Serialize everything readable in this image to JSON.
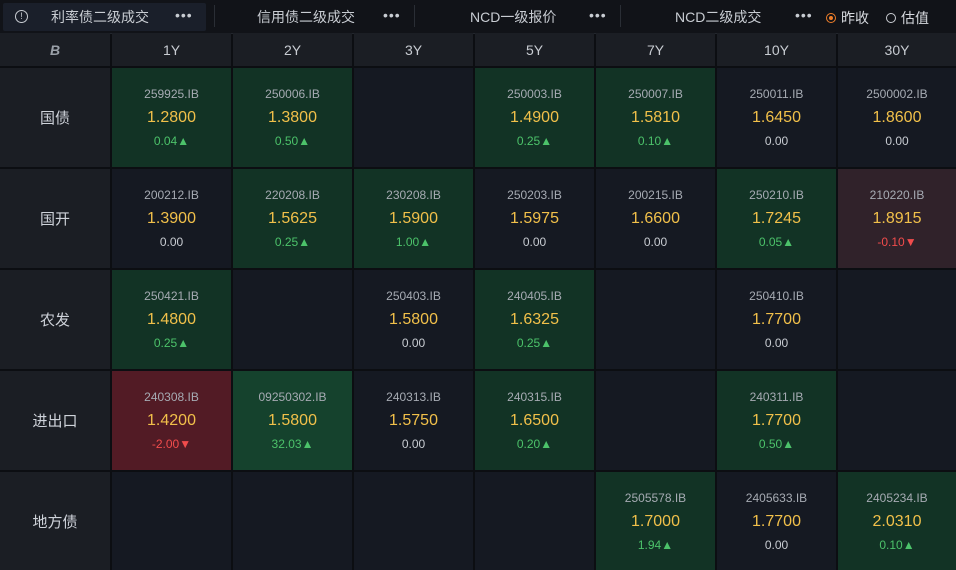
{
  "tabs": [
    {
      "label": "利率债二级成交",
      "active": true
    },
    {
      "label": "信用债二级成交",
      "active": false
    },
    {
      "label": "NCD一级报价",
      "active": false
    },
    {
      "label": "NCD二级成交",
      "active": false
    }
  ],
  "more_label": "•••",
  "radio": {
    "options": [
      {
        "label": "昨收",
        "checked": true
      },
      {
        "label": "估值",
        "checked": false
      }
    ]
  },
  "grid": {
    "logo": "B",
    "columns": [
      "1Y",
      "2Y",
      "3Y",
      "5Y",
      "7Y",
      "10Y",
      "30Y"
    ],
    "rows": [
      {
        "label": "国债",
        "cells": [
          {
            "code": "259925.IB",
            "price": "1.2800",
            "chg": "0.04▲",
            "dir": "up",
            "tone": "g1"
          },
          {
            "code": "250006.IB",
            "price": "1.3800",
            "chg": "0.50▲",
            "dir": "up",
            "tone": "g1"
          },
          {
            "code": "",
            "price": "",
            "chg": "",
            "dir": "",
            "tone": "n"
          },
          {
            "code": "250003.IB",
            "price": "1.4900",
            "chg": "0.25▲",
            "dir": "up",
            "tone": "g1"
          },
          {
            "code": "250007.IB",
            "price": "1.5810",
            "chg": "0.10▲",
            "dir": "up",
            "tone": "g1"
          },
          {
            "code": "250011.IB",
            "price": "1.6450",
            "chg": "0.00",
            "dir": "flat",
            "tone": "n"
          },
          {
            "code": "2500002.IB",
            "price": "1.8600",
            "chg": "0.00",
            "dir": "flat",
            "tone": "n"
          }
        ]
      },
      {
        "label": "国开",
        "cells": [
          {
            "code": "200212.IB",
            "price": "1.3900",
            "chg": "0.00",
            "dir": "flat",
            "tone": "n"
          },
          {
            "code": "220208.IB",
            "price": "1.5625",
            "chg": "0.25▲",
            "dir": "up",
            "tone": "g1"
          },
          {
            "code": "230208.IB",
            "price": "1.5900",
            "chg": "1.00▲",
            "dir": "up",
            "tone": "g1"
          },
          {
            "code": "250203.IB",
            "price": "1.5975",
            "chg": "0.00",
            "dir": "flat",
            "tone": "n"
          },
          {
            "code": "200215.IB",
            "price": "1.6600",
            "chg": "0.00",
            "dir": "flat",
            "tone": "n"
          },
          {
            "code": "250210.IB",
            "price": "1.7245",
            "chg": "0.05▲",
            "dir": "up",
            "tone": "g1"
          },
          {
            "code": "210220.IB",
            "price": "1.8915",
            "chg": "-0.10▼",
            "dir": "down",
            "tone": "r1"
          }
        ]
      },
      {
        "label": "农发",
        "cells": [
          {
            "code": "250421.IB",
            "price": "1.4800",
            "chg": "0.25▲",
            "dir": "up",
            "tone": "g1"
          },
          {
            "code": "",
            "price": "",
            "chg": "",
            "dir": "",
            "tone": "n"
          },
          {
            "code": "250403.IB",
            "price": "1.5800",
            "chg": "0.00",
            "dir": "flat",
            "tone": "n"
          },
          {
            "code": "240405.IB",
            "price": "1.6325",
            "chg": "0.25▲",
            "dir": "up",
            "tone": "g1"
          },
          {
            "code": "",
            "price": "",
            "chg": "",
            "dir": "",
            "tone": "n"
          },
          {
            "code": "250410.IB",
            "price": "1.7700",
            "chg": "0.00",
            "dir": "flat",
            "tone": "n"
          },
          {
            "code": "",
            "price": "",
            "chg": "",
            "dir": "",
            "tone": "n"
          }
        ]
      },
      {
        "label": "进出口",
        "cells": [
          {
            "code": "240308.IB",
            "price": "1.4200",
            "chg": "-2.00▼",
            "dir": "down",
            "tone": "r2"
          },
          {
            "code": "09250302.IB",
            "price": "1.5800",
            "chg": "32.03▲",
            "dir": "up",
            "tone": "g2"
          },
          {
            "code": "240313.IB",
            "price": "1.5750",
            "chg": "0.00",
            "dir": "flat",
            "tone": "n"
          },
          {
            "code": "240315.IB",
            "price": "1.6500",
            "chg": "0.20▲",
            "dir": "up",
            "tone": "g1"
          },
          {
            "code": "",
            "price": "",
            "chg": "",
            "dir": "",
            "tone": "n"
          },
          {
            "code": "240311.IB",
            "price": "1.7700",
            "chg": "0.50▲",
            "dir": "up",
            "tone": "g1"
          },
          {
            "code": "",
            "price": "",
            "chg": "",
            "dir": "",
            "tone": "n"
          }
        ]
      },
      {
        "label": "地方债",
        "cells": [
          {
            "code": "",
            "price": "",
            "chg": "",
            "dir": "",
            "tone": "n"
          },
          {
            "code": "",
            "price": "",
            "chg": "",
            "dir": "",
            "tone": "n"
          },
          {
            "code": "",
            "price": "",
            "chg": "",
            "dir": "",
            "tone": "n"
          },
          {
            "code": "",
            "price": "",
            "chg": "",
            "dir": "",
            "tone": "n"
          },
          {
            "code": "2505578.IB",
            "price": "1.7000",
            "chg": "1.94▲",
            "dir": "up",
            "tone": "g1"
          },
          {
            "code": "2405633.IB",
            "price": "1.7700",
            "chg": "0.00",
            "dir": "flat",
            "tone": "n"
          },
          {
            "code": "2405234.IB",
            "price": "2.0310",
            "chg": "0.10▲",
            "dir": "up",
            "tone": "g1"
          }
        ]
      }
    ]
  }
}
